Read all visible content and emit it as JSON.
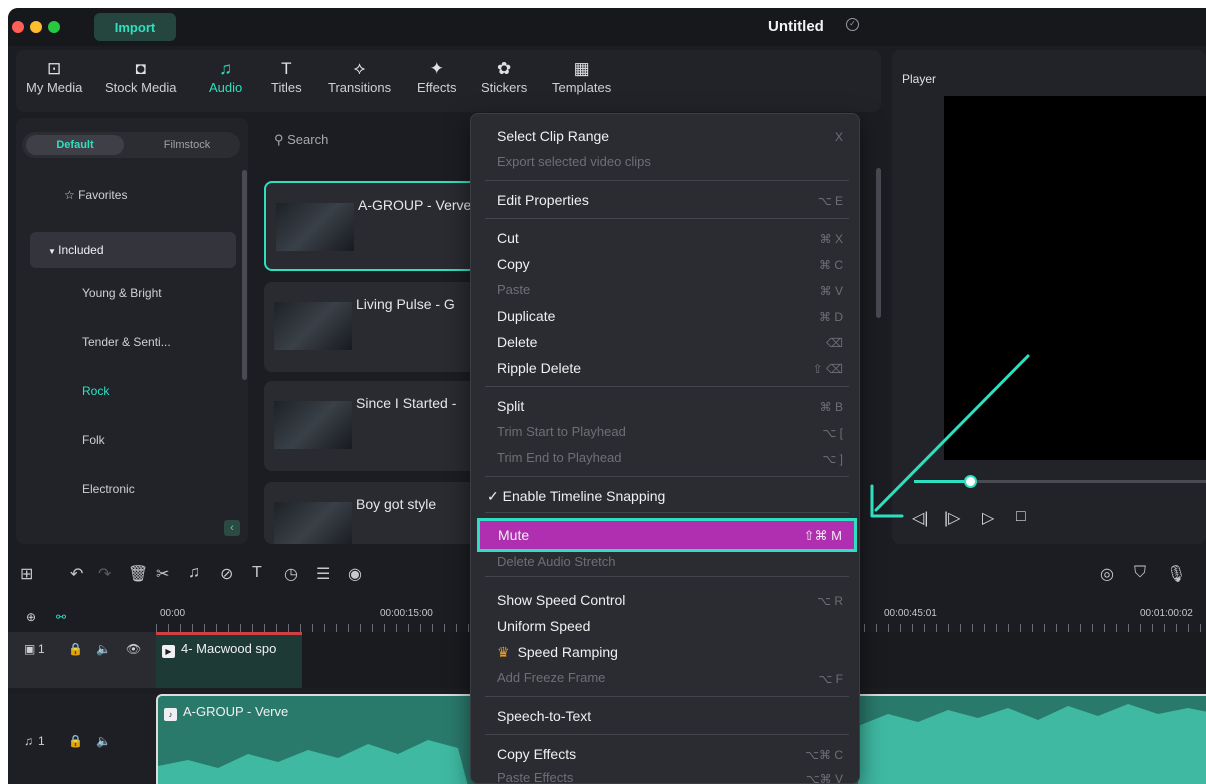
{
  "window": {
    "title": "Untitled",
    "import_label": "Import"
  },
  "toolbar": {
    "tabs": [
      {
        "label": "My Media",
        "icon": "image"
      },
      {
        "label": "Stock Media",
        "icon": "cloud"
      },
      {
        "label": "Audio",
        "icon": "♫"
      },
      {
        "label": "Titles",
        "icon": "T"
      },
      {
        "label": "Transitions",
        "icon": "⟡"
      },
      {
        "label": "Effects",
        "icon": "✦"
      },
      {
        "label": "Stickers",
        "icon": "✿"
      },
      {
        "label": "Templates",
        "icon": "▦"
      }
    ],
    "active_tab": "Audio"
  },
  "sidebar": {
    "segments": [
      "Default",
      "Filmstock"
    ],
    "items": [
      "Favorites",
      "Included",
      "Young & Bright",
      "Tender & Senti...",
      "Rock",
      "Folk",
      "Electronic"
    ],
    "selected": "Rock"
  },
  "search": {
    "label": "Search"
  },
  "media": [
    {
      "title": "A-GROUP - Verve"
    },
    {
      "title": "Living Pulse - G"
    },
    {
      "title": "Since I Started -"
    },
    {
      "title": "Boy got style"
    }
  ],
  "player": {
    "label": "Player"
  },
  "context_menu": {
    "items": [
      {
        "label": "Select Clip Range",
        "shortcut": "X",
        "enabled": true
      },
      {
        "label": "Export selected video clips",
        "shortcut": "",
        "enabled": false
      },
      {
        "label": "Edit Properties",
        "shortcut": "⌥ E",
        "enabled": true
      },
      {
        "label": "Cut",
        "shortcut": "⌘ X",
        "enabled": true
      },
      {
        "label": "Copy",
        "shortcut": "⌘ C",
        "enabled": true
      },
      {
        "label": "Paste",
        "shortcut": "⌘ V",
        "enabled": false
      },
      {
        "label": "Duplicate",
        "shortcut": "⌘ D",
        "enabled": true
      },
      {
        "label": "Delete",
        "shortcut": "⌫",
        "enabled": true
      },
      {
        "label": "Ripple Delete",
        "shortcut": "⇧ ⌫",
        "enabled": true
      },
      {
        "label": "Split",
        "shortcut": "⌘ B",
        "enabled": true
      },
      {
        "label": "Trim Start to Playhead",
        "shortcut": "⌥ [",
        "enabled": false
      },
      {
        "label": "Trim End to Playhead",
        "shortcut": "⌥ ]",
        "enabled": false
      },
      {
        "label": "✓ Enable Timeline Snapping",
        "shortcut": "",
        "enabled": true
      },
      {
        "label": "Mute",
        "shortcut": "⇧⌘ M",
        "enabled": true,
        "highlighted": true
      },
      {
        "label": "Delete Audio Stretch",
        "shortcut": "",
        "enabled": false
      },
      {
        "label": "Show Speed Control",
        "shortcut": "⌥ R",
        "enabled": true
      },
      {
        "label": "Uniform Speed",
        "shortcut": "",
        "enabled": true
      },
      {
        "label": "Speed Ramping",
        "shortcut": "",
        "enabled": true
      },
      {
        "label": "Add Freeze Frame",
        "shortcut": "⌥ F",
        "enabled": false
      },
      {
        "label": "Speech-to-Text",
        "shortcut": "",
        "enabled": true
      },
      {
        "label": "Copy Effects",
        "shortcut": "⌥⌘ C",
        "enabled": true
      },
      {
        "label": "Paste Effects",
        "shortcut": "⌥⌘ V",
        "enabled": false
      }
    ]
  },
  "timeline": {
    "times": [
      "00:00",
      "00:00:15:00",
      "00:00:45:01",
      "00:01:00:02"
    ],
    "video_track": {
      "index": "1",
      "clip": "4- Macwood spo"
    },
    "audio_track": {
      "index": "1",
      "clip": "A-GROUP - Verve"
    }
  },
  "colors": {
    "accent": "#2fe0c0",
    "highlight": "#b02fb0",
    "background": "#1c1d22"
  }
}
